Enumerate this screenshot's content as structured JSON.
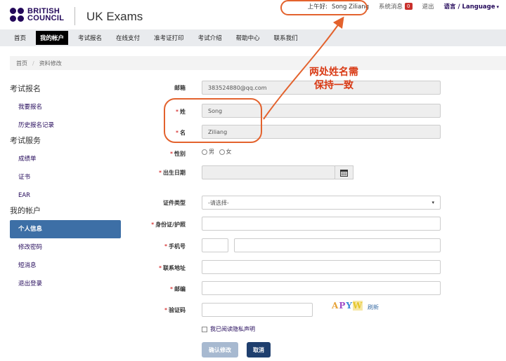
{
  "header": {
    "brand": [
      "BRITISH",
      "COUNCIL"
    ],
    "app_title": "UK Exams",
    "greeting": "上午好:",
    "username": "Song Ziliang",
    "messages_label": "系统消息",
    "messages_count": "0",
    "logout_label": "退出",
    "language_label": "语言 / Language"
  },
  "nav": {
    "items": [
      "首页",
      "我的帐户",
      "考试报名",
      "在线支付",
      "准考证打印",
      "考试介绍",
      "帮助中心",
      "联系我们"
    ],
    "active_index": 1
  },
  "breadcrumb": {
    "home": "首页",
    "current": "资料修改"
  },
  "sidebar": {
    "sections": [
      {
        "title": "考试报名",
        "items": [
          "我要报名",
          "历史报名记录"
        ]
      },
      {
        "title": "考试服务",
        "items": [
          "成绩单",
          "证书",
          "EAR"
        ]
      },
      {
        "title": "我的帐户",
        "items": [
          "个人信息",
          "修改密码",
          "短消息",
          "退出登录"
        ]
      }
    ],
    "active_item": "个人信息"
  },
  "form": {
    "email_label": "邮箱",
    "email_value": "383524880@qq.com",
    "surname_label": "姓",
    "surname_value": "Song",
    "given_label": "名",
    "given_value": "Ziliang",
    "gender_label": "性别",
    "gender_male": "男",
    "gender_female": "女",
    "dob_label": "出生日期",
    "id_type_label": "证件类型",
    "id_type_selected": "-请选择-",
    "id_number_label": "身份证/护照",
    "mobile_label": "手机号",
    "address_label": "联系地址",
    "postcode_label": "邮编",
    "captcha_label": "验证码",
    "captcha_image_text": "APYW",
    "refresh_label": "刷新",
    "privacy_label": "我已阅读隐私声明",
    "confirm_button": "确认修改",
    "cancel_button": "取消"
  },
  "annotation": {
    "line1": "两处姓名需",
    "line2": "保持一致"
  },
  "colors": {
    "brand": "#23085a",
    "active_sidebar": "#3d6fa6",
    "annotation": "#d93b16",
    "badge": "#c9302c",
    "cancel_button": "#1f3f6e",
    "confirm_button": "#a7b9d0"
  },
  "icons": {
    "calendar": "calendar-icon",
    "dropdown": "chevron-down-icon",
    "arrow": "annotation-arrow"
  }
}
